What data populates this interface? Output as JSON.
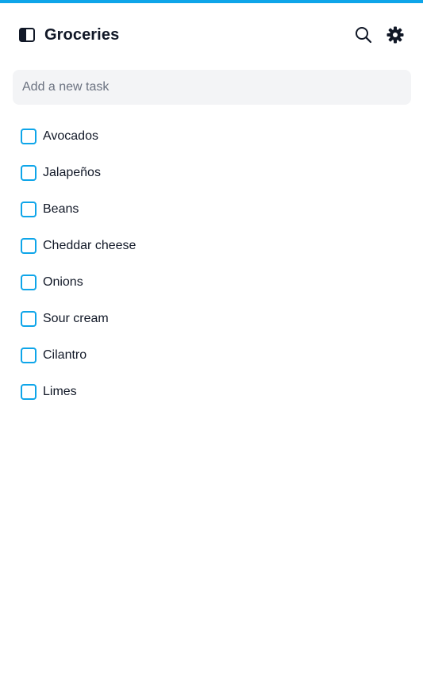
{
  "header": {
    "title": "Groceries",
    "icons": {
      "sidebar_toggle": "sidebar-toggle-icon",
      "search": "search-icon",
      "settings": "gear-icon"
    }
  },
  "new_task": {
    "placeholder": "Add a new task",
    "value": ""
  },
  "tasks": [
    {
      "label": "Avocados",
      "checked": false
    },
    {
      "label": "Jalapeños",
      "checked": false
    },
    {
      "label": "Beans",
      "checked": false
    },
    {
      "label": "Cheddar cheese",
      "checked": false
    },
    {
      "label": "Onions",
      "checked": false
    },
    {
      "label": "Sour cream",
      "checked": false
    },
    {
      "label": "Cilantro",
      "checked": false
    },
    {
      "label": "Limes",
      "checked": false
    }
  ],
  "colors": {
    "accent": "#0ea5e9",
    "text": "#111827",
    "input_background": "#f3f4f6",
    "placeholder": "#6b7280"
  }
}
